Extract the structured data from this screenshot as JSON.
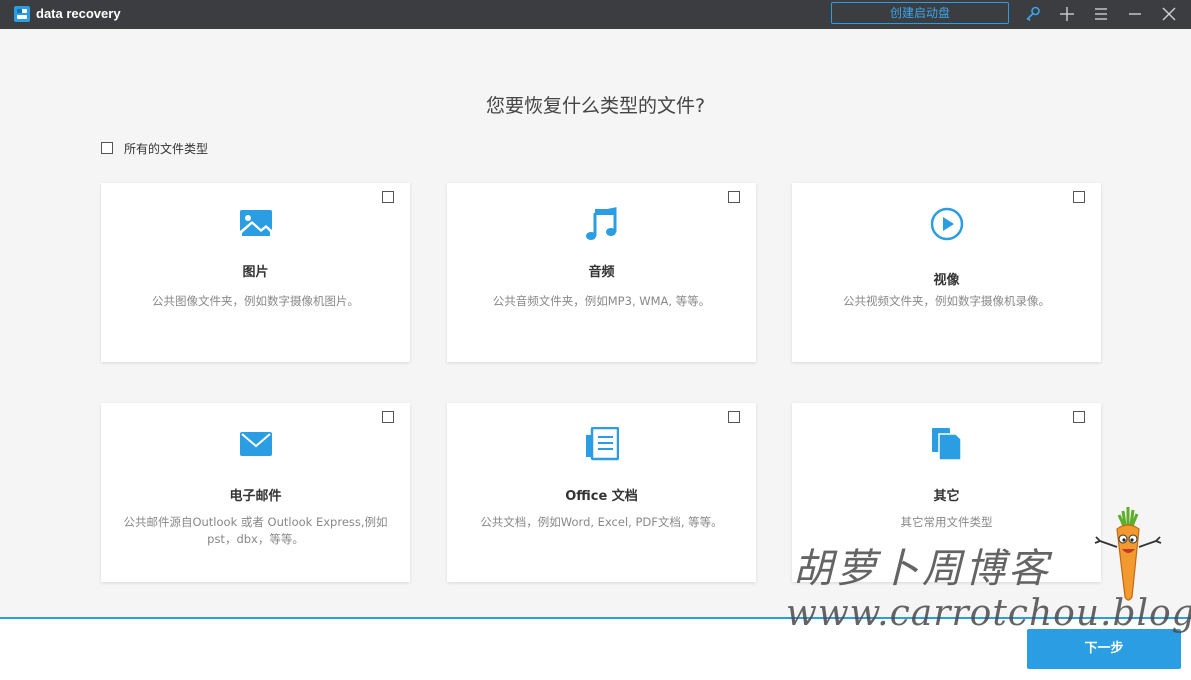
{
  "app": {
    "title": "data recovery"
  },
  "titlebar": {
    "boot_button": "创建启动盘"
  },
  "page": {
    "heading": "您要恢复什么类型的文件?",
    "all_types_label": "所有的文件类型",
    "next_button": "下一步"
  },
  "accent_color": "#2a9de3",
  "cards": [
    {
      "icon": "image-icon",
      "name": "图片",
      "desc": "公共图像文件夹，例如数字摄像机图片。"
    },
    {
      "icon": "music-note-icon",
      "name": "音频",
      "desc": "公共音频文件夹，例如MP3, WMA, 等等。"
    },
    {
      "icon": "play-circle-icon",
      "name": "视像",
      "desc": "公共视频文件夹，例如数字摄像机录像。"
    },
    {
      "icon": "envelope-icon",
      "name": "电子邮件",
      "desc": "公共邮件源自Outlook 或者 Outlook Express,例如pst，dbx，等等。"
    },
    {
      "icon": "document-icon",
      "name": "Office 文档",
      "desc": "公共文档，例如Word, Excel, PDF文档, 等等。"
    },
    {
      "icon": "files-icon",
      "name": "其它",
      "desc": "其它常用文件类型"
    }
  ],
  "watermark": {
    "cn": "胡萝卜周博客",
    "url": "www.carrotchou.blog"
  }
}
